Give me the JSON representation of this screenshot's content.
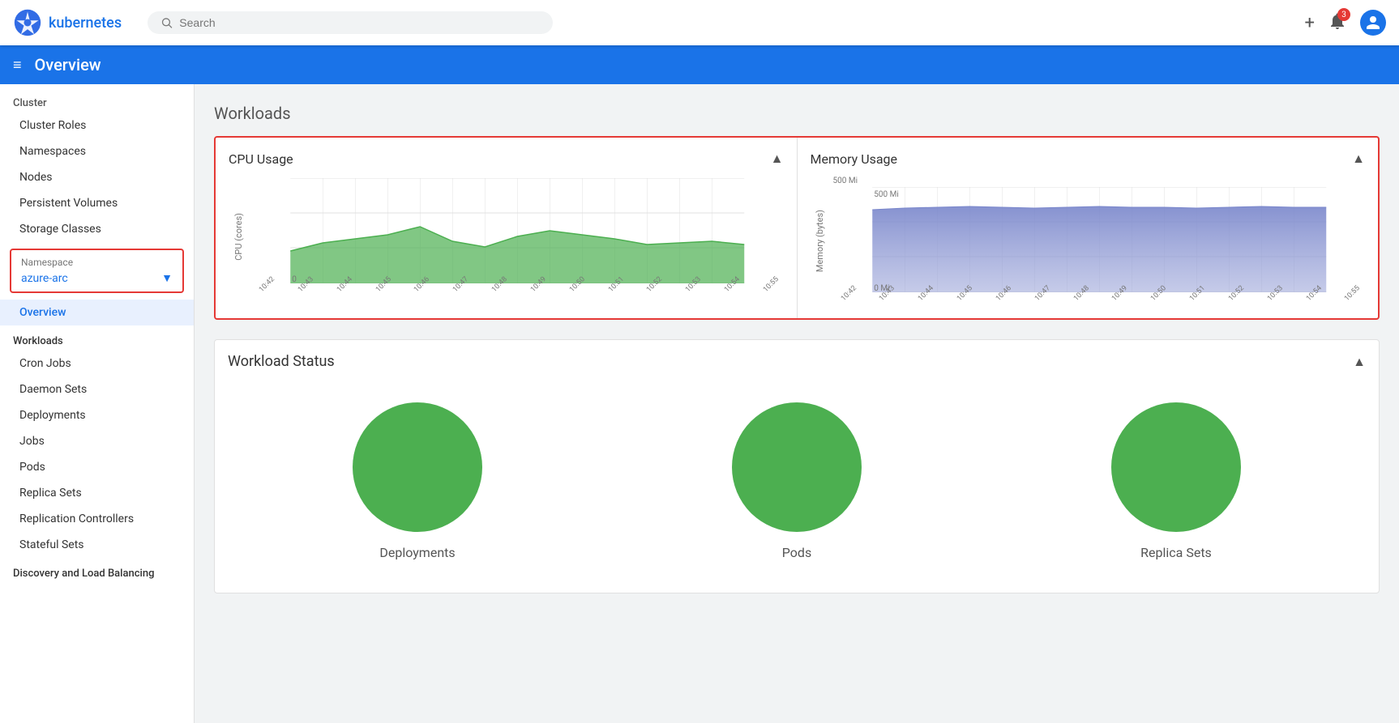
{
  "topnav": {
    "logo_text": "kubernetes",
    "search_placeholder": "Search",
    "notification_count": "3",
    "plus_label": "+",
    "section_title": "Overview",
    "hamburger_icon": "≡"
  },
  "sidebar": {
    "cluster_label": "Cluster",
    "cluster_items": [
      "Cluster Roles",
      "Namespaces",
      "Nodes",
      "Persistent Volumes",
      "Storage Classes"
    ],
    "namespace_label": "Namespace",
    "namespace_value": "azure-arc",
    "overview_label": "Overview",
    "workloads_label": "Workloads",
    "workload_items": [
      "Cron Jobs",
      "Daemon Sets",
      "Deployments",
      "Jobs",
      "Pods",
      "Replica Sets",
      "Replication Controllers",
      "Stateful Sets"
    ],
    "discovery_label": "Discovery and Load Balancing"
  },
  "content": {
    "page_title": "Workloads",
    "cpu_chart": {
      "title": "CPU Usage",
      "y_label": "CPU (cores)",
      "y_max": "",
      "y_min": "0",
      "x_labels": [
        "10:42",
        "10:43",
        "10:44",
        "10:45",
        "10:46",
        "10:47",
        "10:48",
        "10:49",
        "10:50",
        "10:51",
        "10:52",
        "10:53",
        "10:54",
        "10:55"
      ],
      "collapse_icon": "▲"
    },
    "memory_chart": {
      "title": "Memory Usage",
      "y_label": "Memory (bytes)",
      "y_max": "500 Mi",
      "y_min": "0 Mi",
      "x_labels": [
        "10:42",
        "10:43",
        "10:44",
        "10:45",
        "10:46",
        "10:47",
        "10:48",
        "10:49",
        "10:50",
        "10:51",
        "10:52",
        "10:53",
        "10:54",
        "10:55"
      ],
      "collapse_icon": "▲"
    },
    "workload_status": {
      "title": "Workload Status",
      "collapse_icon": "▲",
      "items": [
        {
          "label": "Deployments"
        },
        {
          "label": "Pods"
        },
        {
          "label": "Replica Sets"
        }
      ]
    }
  }
}
